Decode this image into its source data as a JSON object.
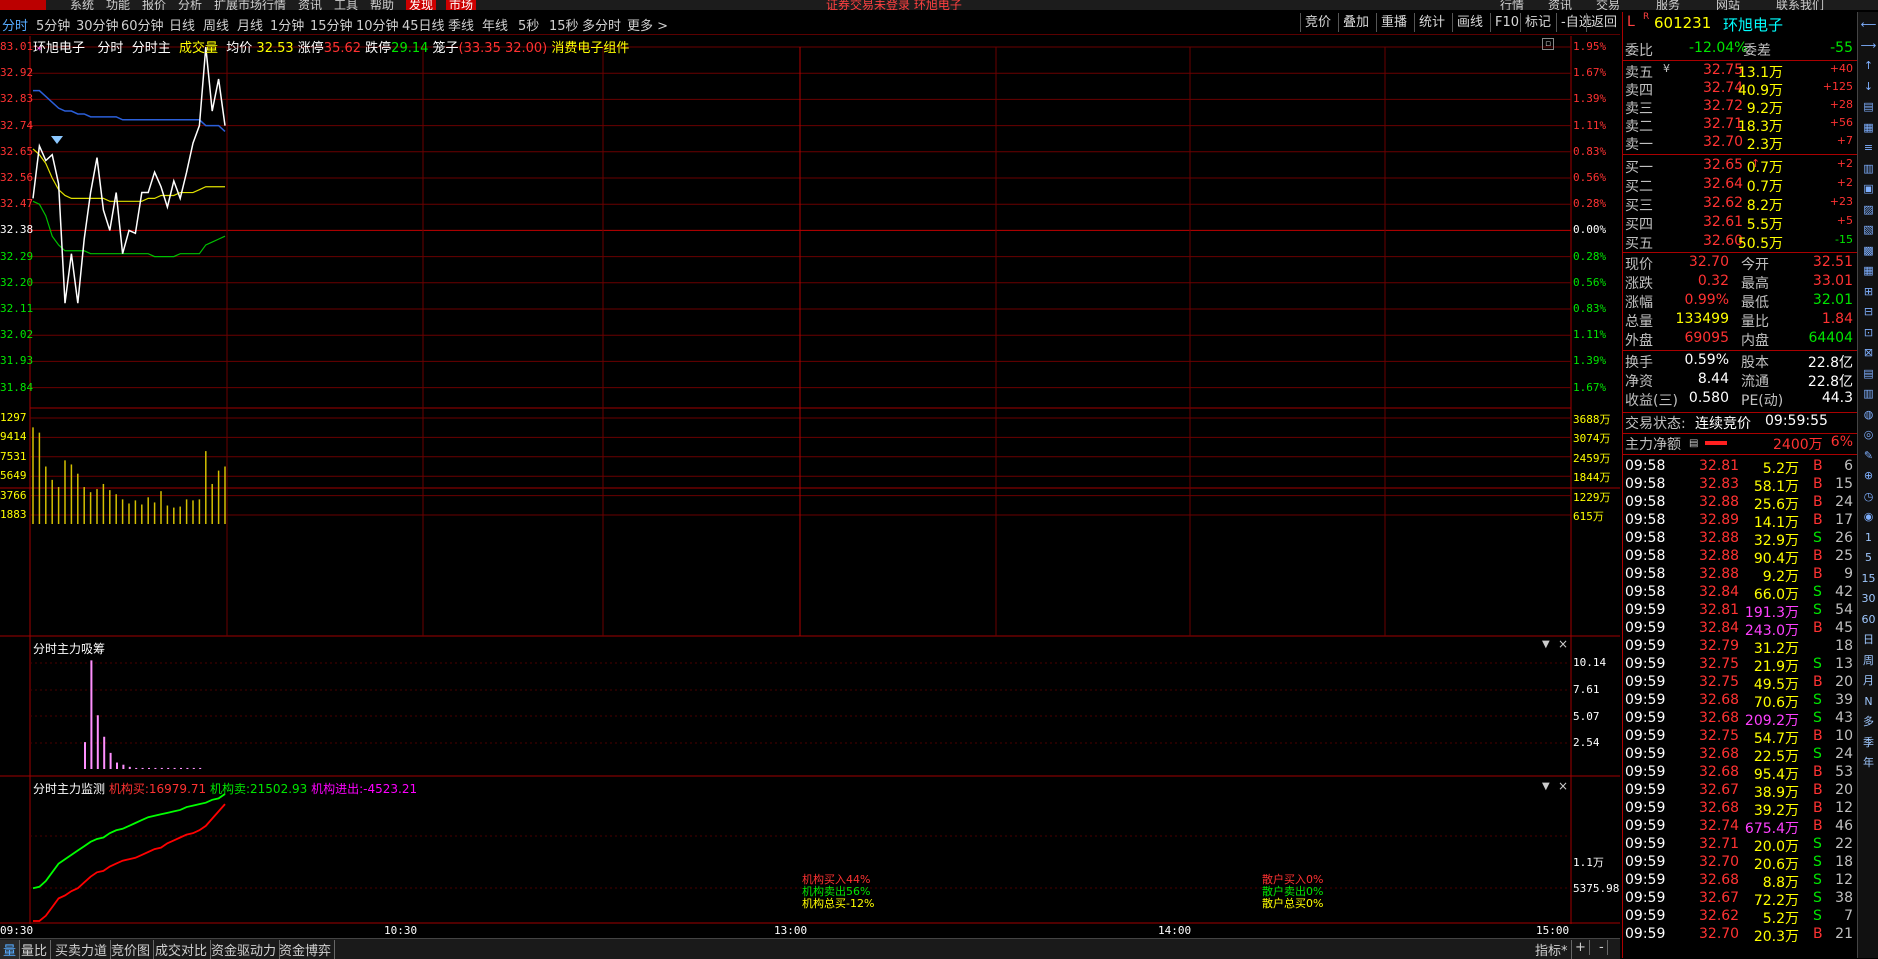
{
  "top_menu": [
    "系统",
    "功能",
    "报价",
    "分析",
    "扩展市场行情",
    "资讯",
    "工具",
    "帮助",
    "发现",
    "市场"
  ],
  "top_notice": "证券交易未登录  环旭电子",
  "top_right": [
    "行情",
    "资讯",
    "交易",
    "服务",
    "网站",
    "联系我们"
  ],
  "periods": [
    "分时",
    "5分钟",
    "30分钟",
    "60分钟",
    "日线",
    "周线",
    "月线",
    "1分钟",
    "15分钟",
    "10分钟",
    "45日线",
    "季线",
    "年线",
    "5秒",
    "15秒",
    "多分时",
    "更多 >"
  ],
  "toolbar": [
    "竞价",
    "叠加",
    "重播",
    "统计",
    "画线",
    "F10",
    "标记",
    "-自选",
    "返回"
  ],
  "header": {
    "name": "环旭电子",
    "mode1": "分时",
    "mode2": "分时主",
    "vol": "成交量",
    "avg_label": "均价",
    "avg": "32.53",
    "zt_label": "涨停",
    "zt": "35.62",
    "dt_label": "跌停",
    "dt": "29.14",
    "cage_label": "笼子",
    "cage": "(33.35 32.00)",
    "sector": "消费电子组件"
  },
  "price_axis_left": [
    "83.01",
    "32.92",
    "32.83",
    "32.74",
    "32.65",
    "32.56",
    "32.47",
    "32.38",
    "32.29",
    "32.20",
    "32.11",
    "32.02",
    "31.93",
    "31.84"
  ],
  "price_axis_right": [
    "1.95%",
    "1.67%",
    "1.39%",
    "1.11%",
    "0.83%",
    "0.56%",
    "0.28%",
    "0.00%",
    "0.28%",
    "0.56%",
    "0.83%",
    "1.11%",
    "1.39%",
    "1.67%"
  ],
  "vol_axis_left": [
    "1297",
    "9414",
    "7531",
    "5649",
    "3766",
    "1883"
  ],
  "vol_axis_right": [
    "3688万",
    "3074万",
    "2459万",
    "1844万",
    "1229万",
    "615万"
  ],
  "panel2": {
    "title": "分时主力吸筹",
    "axis": [
      "10.14",
      "7.61",
      "5.07",
      "2.54"
    ]
  },
  "panel3": {
    "title": "分时主力监测",
    "buy_label": "机构买:",
    "buy": "16979.71",
    "sell_label": "机构卖:",
    "sell": "21502.93",
    "net_label": "机构进出:",
    "net": "-4523.21",
    "axis": [
      "1.1万",
      "5375.98"
    ],
    "stats_inst": [
      "机构买入44%",
      "机构卖出56%",
      "机构总买-12%"
    ],
    "stats_retail": [
      "散户买入0%",
      "散户卖出0%",
      "散户总买0%"
    ]
  },
  "time_axis": [
    "09:30",
    "10:30",
    "13:00",
    "14:00",
    "15:00"
  ],
  "bottom_tabs": [
    "量",
    "量比",
    "买卖力道",
    "竞价图",
    "成交对比",
    "资金驱动力",
    "资金博弈"
  ],
  "bottom_right": [
    "指标*",
    "+",
    "-"
  ],
  "stock": {
    "prefix": "L",
    "code": "601231",
    "name": "环旭电子",
    "webi_label": "委比",
    "webi": "-12.04%",
    "weicha_label": "委差",
    "weicha": "-55"
  },
  "asks": [
    {
      "label": "卖五",
      "price": "32.75",
      "vol": "13.1万",
      "chg": "+40",
      "mark": "¥"
    },
    {
      "label": "卖四",
      "price": "32.74",
      "vol": "40.9万",
      "chg": "+125",
      "mark": ""
    },
    {
      "label": "卖三",
      "price": "32.72",
      "vol": "9.2万",
      "chg": "+28",
      "mark": ""
    },
    {
      "label": "卖二",
      "price": "32.71",
      "vol": "18.3万",
      "chg": "+56",
      "mark": ""
    },
    {
      "label": "卖一",
      "price": "32.70",
      "vol": "2.3万",
      "chg": "+7",
      "mark": ""
    }
  ],
  "bids": [
    {
      "label": "买一",
      "price": "32.65",
      "vol": "0.7万",
      "chg": "+2",
      "mark": "↑"
    },
    {
      "label": "买二",
      "price": "32.64",
      "vol": "0.7万",
      "chg": "+2",
      "mark": ""
    },
    {
      "label": "买三",
      "price": "32.62",
      "vol": "8.2万",
      "chg": "+23",
      "mark": ""
    },
    {
      "label": "买四",
      "price": "32.61",
      "vol": "5.5万",
      "chg": "+5",
      "mark": ""
    },
    {
      "label": "买五",
      "price": "32.60",
      "vol": "50.5万",
      "chg": "-15",
      "mark": ""
    }
  ],
  "quote": [
    {
      "l1": "现价",
      "v1": "32.70",
      "c1": "red",
      "l2": "今开",
      "v2": "32.51",
      "c2": "red"
    },
    {
      "l1": "涨跌",
      "v1": "0.32",
      "c1": "red",
      "l2": "最高",
      "v2": "33.01",
      "c2": "red"
    },
    {
      "l1": "涨幅",
      "v1": "0.99%",
      "c1": "red",
      "l2": "最低",
      "v2": "32.01",
      "c2": "green"
    },
    {
      "l1": "总量",
      "v1": "133499",
      "c1": "yellow",
      "l2": "量比",
      "v2": "1.84",
      "c2": "red"
    },
    {
      "l1": "外盘",
      "v1": "69095",
      "c1": "red",
      "l2": "内盘",
      "v2": "64404",
      "c2": "green"
    }
  ],
  "quote2": [
    {
      "l1": "换手",
      "v1": "0.59%",
      "l2": "股本",
      "v2": "22.8亿"
    },
    {
      "l1": "净资",
      "v1": "8.44",
      "l2": "流通",
      "v2": "22.8亿"
    },
    {
      "l1": "收益(三)",
      "v1": "0.580",
      "l2": "PE(动)",
      "v2": "44.3"
    }
  ],
  "trade_status_label": "交易状态:",
  "trade_status": "连续竞价",
  "trade_time": "09:59:55",
  "main_net_label": "主力净额",
  "main_net": "2400万",
  "main_net_pct": "6%",
  "ticks": [
    {
      "t": "09:58",
      "p": "32.81",
      "v": "5.2万",
      "s": "B",
      "n": "6"
    },
    {
      "t": "09:58",
      "p": "32.83",
      "v": "58.1万",
      "s": "B",
      "n": "15"
    },
    {
      "t": "09:58",
      "p": "32.88",
      "v": "25.6万",
      "s": "B",
      "n": "24"
    },
    {
      "t": "09:58",
      "p": "32.89",
      "v": "14.1万",
      "s": "B",
      "n": "17"
    },
    {
      "t": "09:58",
      "p": "32.88",
      "v": "32.9万",
      "s": "S",
      "n": "26"
    },
    {
      "t": "09:58",
      "p": "32.88",
      "v": "90.4万",
      "s": "B",
      "n": "25"
    },
    {
      "t": "09:58",
      "p": "32.88",
      "v": "9.2万",
      "s": "B",
      "n": "9"
    },
    {
      "t": "09:58",
      "p": "32.84",
      "v": "66.0万",
      "s": "S",
      "n": "42"
    },
    {
      "t": "09:59",
      "p": "32.81",
      "v": "191.3万",
      "s": "S",
      "n": "54"
    },
    {
      "t": "09:59",
      "p": "32.84",
      "v": "243.0万",
      "s": "B",
      "n": "45"
    },
    {
      "t": "09:59",
      "p": "32.79",
      "v": "31.2万",
      "s": "",
      "n": "18"
    },
    {
      "t": "09:59",
      "p": "32.75",
      "v": "21.9万",
      "s": "S",
      "n": "13"
    },
    {
      "t": "09:59",
      "p": "32.75",
      "v": "49.5万",
      "s": "B",
      "n": "20"
    },
    {
      "t": "09:59",
      "p": "32.68",
      "v": "70.6万",
      "s": "S",
      "n": "39"
    },
    {
      "t": "09:59",
      "p": "32.68",
      "v": "209.2万",
      "s": "S",
      "n": "43"
    },
    {
      "t": "09:59",
      "p": "32.75",
      "v": "54.7万",
      "s": "B",
      "n": "10"
    },
    {
      "t": "09:59",
      "p": "32.68",
      "v": "22.5万",
      "s": "S",
      "n": "24"
    },
    {
      "t": "09:59",
      "p": "32.68",
      "v": "95.4万",
      "s": "B",
      "n": "53"
    },
    {
      "t": "09:59",
      "p": "32.67",
      "v": "38.9万",
      "s": "B",
      "n": "20"
    },
    {
      "t": "09:59",
      "p": "32.68",
      "v": "39.2万",
      "s": "B",
      "n": "12"
    },
    {
      "t": "09:59",
      "p": "32.74",
      "v": "675.4万",
      "s": "B",
      "n": "46"
    },
    {
      "t": "09:59",
      "p": "32.71",
      "v": "20.0万",
      "s": "S",
      "n": "22"
    },
    {
      "t": "09:59",
      "p": "32.70",
      "v": "20.6万",
      "s": "S",
      "n": "18"
    },
    {
      "t": "09:59",
      "p": "32.68",
      "v": "8.8万",
      "s": "S",
      "n": "12"
    },
    {
      "t": "09:59",
      "p": "32.67",
      "v": "72.2万",
      "s": "S",
      "n": "38"
    },
    {
      "t": "09:59",
      "p": "32.62",
      "v": "5.2万",
      "s": "S",
      "n": "7"
    },
    {
      "t": "09:59",
      "p": "32.70",
      "v": "20.3万",
      "s": "B",
      "n": "21"
    }
  ],
  "side_icons": [
    "⟵",
    "⟶",
    "↑",
    "↓",
    "▤",
    "▦",
    "≡",
    "▥",
    "▣",
    "▨",
    "▧",
    "▩",
    "▦",
    "⊞",
    "⊟",
    "⊡",
    "⊠",
    "▤",
    "▥",
    "◍",
    "◎",
    "✎",
    "⊕",
    "◷",
    "◉",
    "1",
    "5",
    "15",
    "30",
    "60",
    "日",
    "周",
    "月",
    "N",
    "多",
    "季",
    "年"
  ],
  "chart_data": {
    "type": "line",
    "series": [
      {
        "name": "price",
        "values": [
          32.49,
          32.67,
          32.62,
          32.64,
          32.54,
          32.13,
          32.3,
          32.13,
          32.35,
          32.51,
          32.63,
          32.45,
          32.38,
          32.51,
          32.3,
          32.38,
          32.37,
          32.51,
          32.51,
          32.58,
          32.53,
          32.46,
          32.55,
          32.49,
          32.58,
          32.68,
          32.74,
          33.01,
          32.79,
          32.9,
          32.74
        ]
      },
      {
        "name": "avg",
        "values": [
          32.66,
          32.64,
          32.61,
          32.56,
          32.52,
          32.5,
          32.49,
          32.49,
          32.49,
          32.49,
          32.49,
          32.49,
          32.48,
          32.48,
          32.48,
          32.48,
          32.48,
          32.48,
          32.49,
          32.49,
          32.5,
          32.5,
          32.5,
          32.51,
          32.51,
          32.51,
          32.52,
          32.53,
          32.53,
          32.53,
          32.53
        ]
      },
      {
        "name": "upper",
        "values": [
          32.86,
          32.86,
          32.84,
          32.82,
          32.8,
          32.79,
          32.79,
          32.78,
          32.78,
          32.77,
          32.77,
          32.77,
          32.77,
          32.77,
          32.76,
          32.76,
          32.76,
          32.76,
          32.76,
          32.76,
          32.76,
          32.76,
          32.76,
          32.76,
          32.76,
          32.76,
          32.76,
          32.74,
          32.74,
          32.74,
          32.72
        ]
      },
      {
        "name": "lower",
        "values": [
          32.48,
          32.47,
          32.43,
          32.36,
          32.33,
          32.31,
          32.31,
          32.31,
          32.31,
          32.3,
          32.3,
          32.3,
          32.3,
          32.3,
          32.3,
          32.3,
          32.3,
          32.3,
          32.3,
          32.29,
          32.29,
          32.29,
          32.29,
          32.3,
          32.3,
          32.3,
          32.3,
          32.33,
          32.34,
          32.35,
          32.36
        ]
      }
    ],
    "volume": [
      9414,
      8900,
      5600,
      4300,
      3600,
      6200,
      5800,
      4900,
      3600,
      3100,
      3400,
      3900,
      3300,
      2900,
      2400,
      2000,
      2300,
      1900,
      2600,
      2100,
      3200,
      1800,
      1600,
      1700,
      2400,
      2300,
      2400,
      7100,
      3900,
      5200,
      5600
    ],
    "absorb": [
      0,
      0,
      0,
      0,
      0,
      2.5,
      10.1,
      5.0,
      3.0,
      1.5,
      0.6,
      0.4,
      0.2,
      0.1,
      0.1,
      0.1,
      0.1,
      0.1,
      0.1,
      0.1,
      0.1,
      0.1,
      0.1,
      0.1,
      0,
      0,
      0,
      0,
      0,
      0,
      0
    ],
    "inst_sell": [
      0.35,
      0.36,
      0.4,
      0.46,
      0.52,
      0.55,
      0.58,
      0.61,
      0.64,
      0.67,
      0.69,
      0.7,
      0.73,
      0.75,
      0.76,
      0.78,
      0.8,
      0.82,
      0.84,
      0.85,
      0.86,
      0.87,
      0.88,
      0.89,
      0.91,
      0.92,
      0.93,
      0.94,
      0.96,
      0.97,
      1.0
    ],
    "inst_buy": [
      0.1,
      0.12,
      0.16,
      0.22,
      0.28,
      0.3,
      0.33,
      0.35,
      0.39,
      0.43,
      0.46,
      0.47,
      0.5,
      0.52,
      0.54,
      0.55,
      0.56,
      0.58,
      0.6,
      0.62,
      0.63,
      0.66,
      0.68,
      0.7,
      0.72,
      0.73,
      0.75,
      0.78,
      0.83,
      0.88,
      0.93
    ],
    "ylim": [
      31.75,
      33.01
    ],
    "base_price": 32.38
  }
}
